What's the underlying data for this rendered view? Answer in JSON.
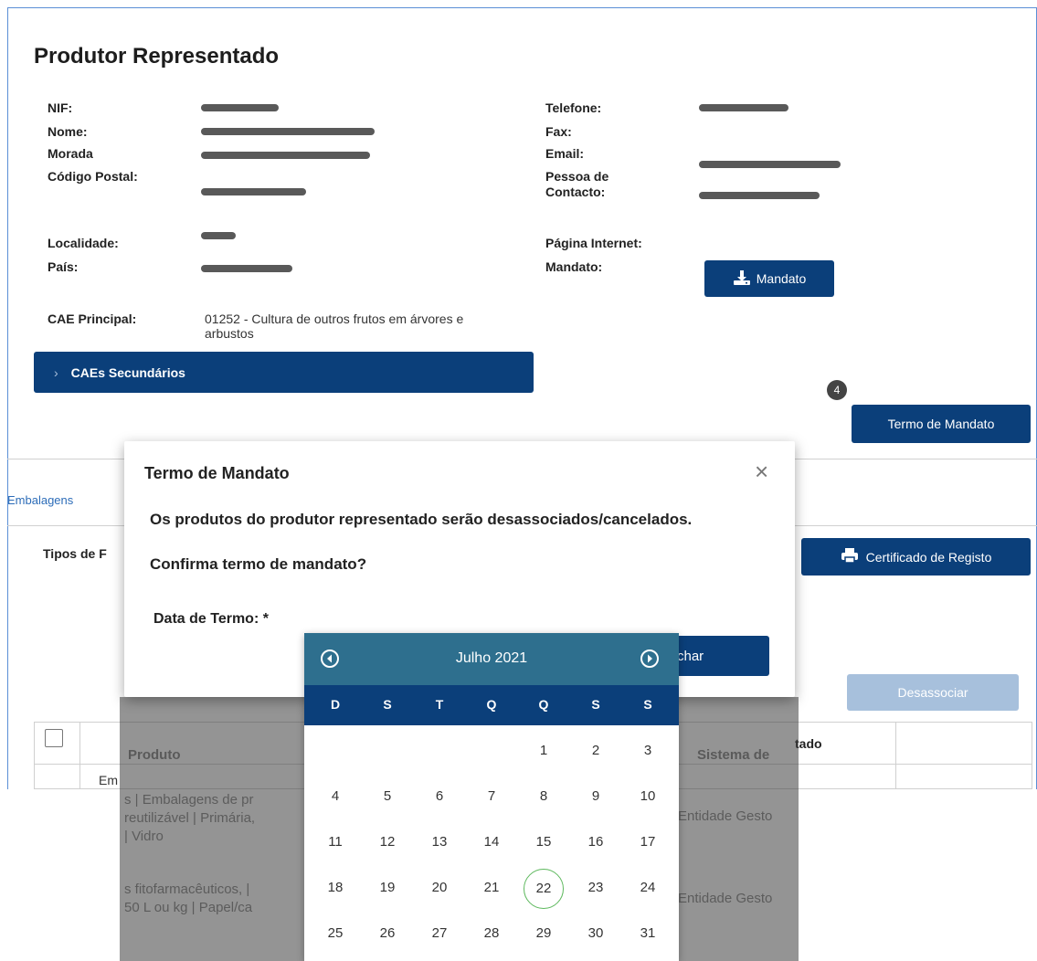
{
  "header": {
    "title": "Produtor Representado"
  },
  "fields_left": [
    {
      "label": "NIF:"
    },
    {
      "label": "Nome:"
    },
    {
      "label": "Morada"
    },
    {
      "label": "Código Postal:"
    },
    {
      "label": "Localidade:"
    },
    {
      "label": "País:"
    }
  ],
  "fields_right": [
    {
      "label": "Telefone:"
    },
    {
      "label": "Fax:"
    },
    {
      "label": "Email:"
    },
    {
      "label": "Pessoa de Contacto:"
    },
    {
      "label": "Página Internet:"
    },
    {
      "label": "Mandato:"
    }
  ],
  "cae": {
    "label": "CAE Principal:",
    "value": "01252 - Cultura de outros frutos em árvores e arbustos",
    "secondary_label": "CAEs Secundários"
  },
  "buttons": {
    "mandato": "Mandato",
    "termo": "Termo de Mandato",
    "certificado": "Certificado de Registo",
    "desassociar": "Desassociar",
    "fechar_partial": "char"
  },
  "badge": "4",
  "tabs": {
    "embalagens": "Embalagens"
  },
  "tipos_label": "Tipos de F",
  "table": {
    "col_produto": "Produto",
    "col_sistema": "Sistema de",
    "col_estado": "tado",
    "row1_prefix": "Em",
    "row1_product": [
      "s | Embalagens de pr",
      "reutilizável | Primária,",
      "| Vidro"
    ],
    "row1_sistema": "Entidade Gesto",
    "row2_product": [
      "s fitofarmacêuticos, |",
      "50 L ou kg | Papel/ca"
    ],
    "row2_sistema": "Entidade Gesto"
  },
  "modal": {
    "title": "Termo de Mandato",
    "close_icon": "×",
    "message1": "Os produtos do produtor representado serão desassociados/cancelados.",
    "message2": "Confirma termo de mandato?",
    "date_label": "Data de Termo: *"
  },
  "calendar": {
    "month_label": "Julho 2021",
    "weekdays": [
      "D",
      "S",
      "T",
      "Q",
      "Q",
      "S",
      "S"
    ],
    "weeks": [
      [
        "",
        "",
        "",
        "",
        "1",
        "2",
        "3"
      ],
      [
        "4",
        "5",
        "6",
        "7",
        "8",
        "9",
        "10"
      ],
      [
        "11",
        "12",
        "13",
        "14",
        "15",
        "16",
        "17"
      ],
      [
        "18",
        "19",
        "20",
        "21",
        "22",
        "23",
        "24"
      ],
      [
        "25",
        "26",
        "27",
        "28",
        "29",
        "30",
        "31"
      ]
    ],
    "selected": "22"
  }
}
